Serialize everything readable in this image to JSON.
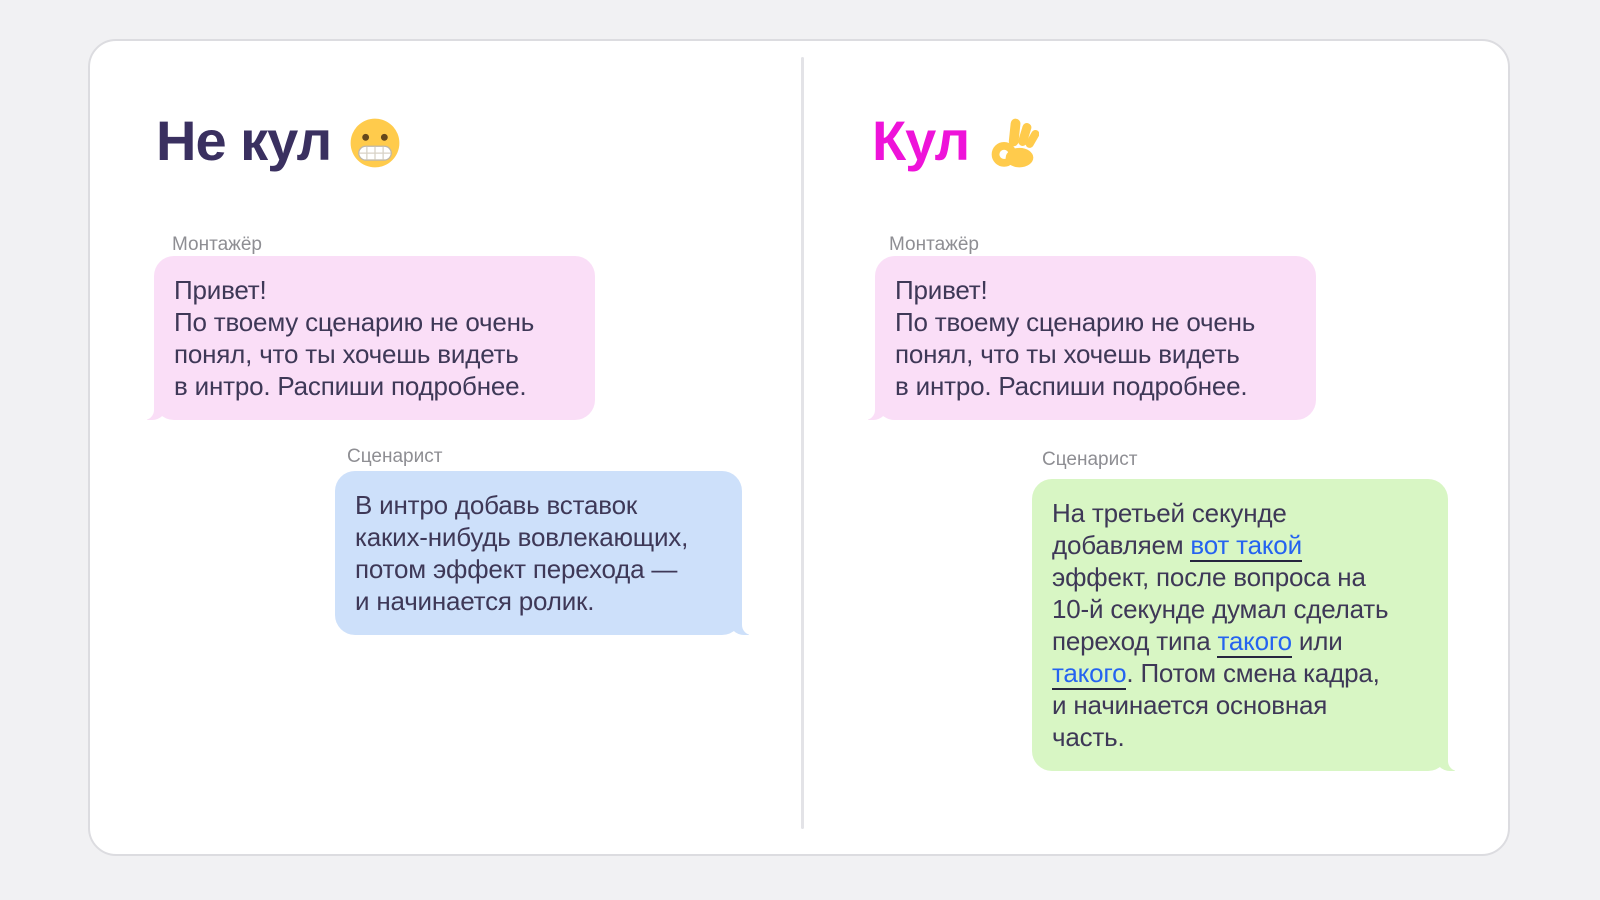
{
  "colors": {
    "page-bg": "#f1f1f3",
    "card-bg": "#ffffff",
    "card-border": "#dcdce0",
    "divider": "#e3e3e7",
    "title-dark": "#3a3060",
    "title-magenta": "#ee13d9",
    "author-label": "#8e8e93",
    "bubble-text": "#3e3857",
    "pink-bubble": "#fadef7",
    "blue-bubble": "#cde0fa",
    "green-bubble": "#d8f6c4",
    "link-blue": "#2563f0",
    "link-underline": "#26263e"
  },
  "panels": [
    {
      "id": "not-cool",
      "title": "Не кул",
      "emoji": "grimacing-face",
      "messages": [
        {
          "author": "Монтажёр",
          "side": "incoming",
          "segments": [
            {
              "text": "Привет!\nПо твоему сценарию не очень\nпонял, что ты хочешь видеть\nв интро. Распиши подробнее."
            }
          ]
        },
        {
          "author": "Сценарист",
          "side": "outgoing",
          "segments": [
            {
              "text": "В интро добавь вставок\nкаких-нибудь вовлекающих,\nпотом эффект перехода —\nи начинается ролик."
            }
          ]
        }
      ]
    },
    {
      "id": "cool",
      "title": "Кул",
      "emoji": "ok-hand",
      "messages": [
        {
          "author": "Монтажёр",
          "side": "incoming",
          "segments": [
            {
              "text": "Привет!\nПо твоему сценарию не очень\nпонял, что ты хочешь видеть\nв интро. Распиши подробнее."
            }
          ]
        },
        {
          "author": "Сценарист",
          "side": "outgoing",
          "segments": [
            {
              "text": "На третьей секунде\nдобавляем "
            },
            {
              "text": "вот такой",
              "link": true
            },
            {
              "text": "\nэффект, после вопроса на\n10-й секунде думал сделать\nпереход типа "
            },
            {
              "text": "такого",
              "link": true
            },
            {
              "text": " или\n"
            },
            {
              "text": "такого",
              "link": true
            },
            {
              "text": ". Потом смена кадра,\nи начинается основная\nчасть."
            }
          ]
        }
      ]
    }
  ]
}
